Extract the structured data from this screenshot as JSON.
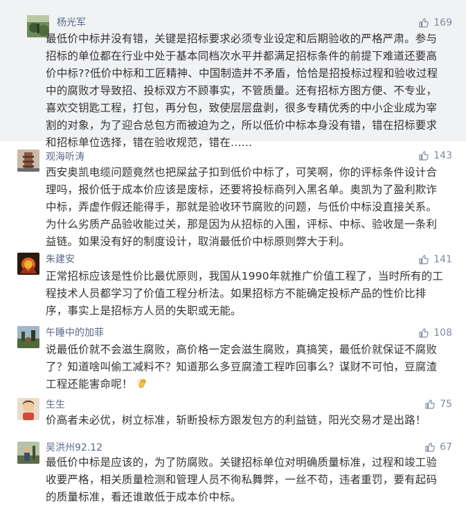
{
  "comments": [
    {
      "username": "杨光军",
      "likes": "169",
      "text": "最低价中标并没有错，关键是招标要求必须专业设定和后期验收的严格严肃。参与招标的单位都在行业中处于基本同档次水平并都满足招标条件的前提下难道还要高价中标??低价中标和工匠精神、中国制造并不矛盾，恰恰是招投标过程和验收过程中的腐败才导致招、投标双方不顾事实，不管质量。还有招标方图方便、不专业，喜欢交钥匙工程，打包，再分包，致使层层盘剥，很多专精优秀的中小企业成为宰割的对象，为了迎合总包方而被迫为之，所以低价中标本身没有错，错在招标要求和招标单位选择，错在验收规范，错在……"
    },
    {
      "username": "观海听涛",
      "likes": "143",
      "text": "西安奥凯电缆问题竟然也把屎盆子扣到低价中标了，可笑啊，你的评标条件设计合理吗，报价低于成本价应该是废标，还要将投标商列入黑名单。奥凯为了盈利欺诈中标，弄虚作假还能得手，那就是验收环节腐败的问题，与低价中标没直接关系。为什么劣质产品验收能过关，那是因为从招标的入围，评标、中标、验收是一条利益链。如果没有好的制度设计，取消最低价中标原则弊大于利。"
    },
    {
      "username": "朱建安",
      "likes": "141",
      "text": "正常招标应该是性价比最优原则，我国从1990年就推广价值工程了，当时所有的工程技术人员都学习了价值工程分析法。如果招标方不能确定投标产品的性价比排序，事实上是招标方人员的失职或无能。"
    },
    {
      "username": "午睡中的加菲",
      "likes": "108",
      "text": "说最低价就不会滋生腐败，高价格一定会滋生腐败，真搞笑，最低价就保证不腐败了？知道啥叫偷工减料不？知道那么多豆腐渣工程咋回事么？谋财不可怕，豆腐渣工程还能害命呢！"
    },
    {
      "username": "生生",
      "likes": "75",
      "text": "价高者未必优，树立标准，斩断投标方跟发包方的利益链，阳光交易才是出路！"
    },
    {
      "username": "吴洪州92.12",
      "likes": "67",
      "text": "最低价中标是应该的，为了防腐败。关键招标单位对明确质量标准，过程和竣工验收要严格，相关质量检测和管理人员不徇私舞弊，一丝不苟，违者重罚，要有起码的质量标准，看还谁敢低于成本价中标。"
    }
  ],
  "colors": {
    "username": "#5b6a8a",
    "likes": "#7f8a9e",
    "text": "#333333",
    "shaded_background": "#f1f2f4"
  },
  "icons": {
    "like": "thumbs-up-icon",
    "emoji": "clapping-hands-emoji"
  }
}
